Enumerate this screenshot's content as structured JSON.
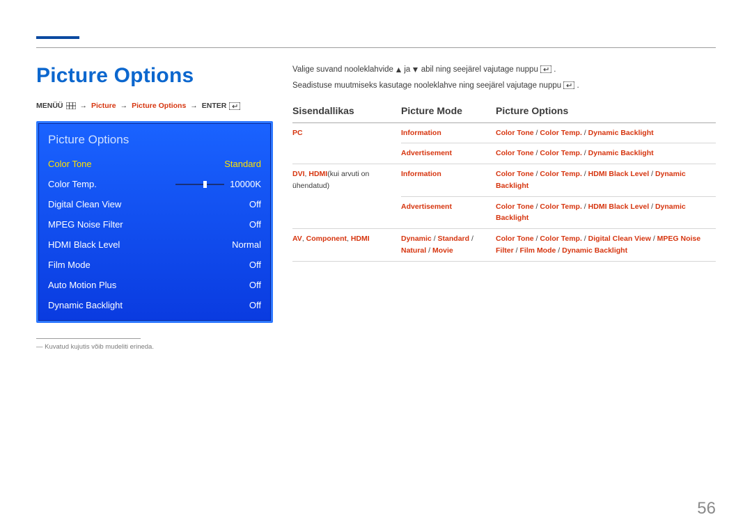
{
  "page_number": "56",
  "title": "Picture Options",
  "breadcrumb": {
    "menu": "MENÜÜ",
    "picture": "Picture",
    "picture_options": "Picture Options",
    "enter": "ENTER",
    "arrow": "→"
  },
  "osd": {
    "title": "Picture Options",
    "rows": [
      {
        "label": "Color Tone",
        "value": "Standard",
        "selected": true
      },
      {
        "label": "Color Temp.",
        "value": "10000K",
        "slider": true
      },
      {
        "label": "Digital Clean View",
        "value": "Off"
      },
      {
        "label": "MPEG Noise Filter",
        "value": "Off"
      },
      {
        "label": "HDMI Black Level",
        "value": "Normal"
      },
      {
        "label": "Film Mode",
        "value": "Off"
      },
      {
        "label": "Auto Motion Plus",
        "value": "Off"
      },
      {
        "label": "Dynamic Backlight",
        "value": "Off"
      }
    ]
  },
  "footnote": {
    "dash": "―",
    "text": "Kuvatud kujutis võib mudeliti erineda."
  },
  "instructions": {
    "line1_a": "Valige suvand nooleklahvide ",
    "line1_b": " ja ",
    "line1_c": " abil ning seejärel vajutage nuppu ",
    "line1_d": ".",
    "line2_a": "Seadistuse muutmiseks kasutage nooleklahve ning seejärel vajutage nuppu ",
    "line2_b": "."
  },
  "table": {
    "headers": [
      "Sisendallikas",
      "Picture Mode",
      "Picture Options"
    ],
    "rows": [
      {
        "src": [
          {
            "t": "PC",
            "r": true
          }
        ],
        "cells": [
          {
            "mode": [
              {
                "t": "Information",
                "r": true
              }
            ],
            "opts": [
              {
                "t": "Color Tone",
                "r": true
              },
              {
                "t": " / "
              },
              {
                "t": "Color Temp.",
                "r": true
              },
              {
                "t": " / "
              },
              {
                "t": "Dynamic Backlight",
                "r": true
              }
            ]
          },
          {
            "mode": [
              {
                "t": "Advertisement",
                "r": true
              }
            ],
            "opts": [
              {
                "t": "Color Tone",
                "r": true
              },
              {
                "t": " / "
              },
              {
                "t": "Color Temp.",
                "r": true
              },
              {
                "t": " / "
              },
              {
                "t": "Dynamic Backlight",
                "r": true
              }
            ]
          }
        ]
      },
      {
        "src": [
          {
            "t": "DVI",
            "r": true
          },
          {
            "t": ", "
          },
          {
            "t": "HDMI",
            "r": true
          },
          {
            "t": "(kui arvuti on ühendatud)"
          }
        ],
        "cells": [
          {
            "mode": [
              {
                "t": "Information",
                "r": true
              }
            ],
            "opts": [
              {
                "t": "Color Tone",
                "r": true
              },
              {
                "t": " / "
              },
              {
                "t": "Color Temp.",
                "r": true
              },
              {
                "t": " / "
              },
              {
                "t": "HDMI Black Level",
                "r": true
              },
              {
                "t": " / "
              },
              {
                "t": "Dynamic Backlight",
                "r": true
              }
            ]
          },
          {
            "mode": [
              {
                "t": "Advertisement",
                "r": true
              }
            ],
            "opts": [
              {
                "t": "Color Tone",
                "r": true
              },
              {
                "t": " / "
              },
              {
                "t": "Color Temp.",
                "r": true
              },
              {
                "t": " / "
              },
              {
                "t": "HDMI Black Level",
                "r": true
              },
              {
                "t": " / "
              },
              {
                "t": "Dynamic Backlight",
                "r": true
              }
            ]
          }
        ]
      },
      {
        "src": [
          {
            "t": "AV",
            "r": true
          },
          {
            "t": ", "
          },
          {
            "t": "Component",
            "r": true
          },
          {
            "t": ", "
          },
          {
            "t": "HDMI",
            "r": true
          }
        ],
        "cells": [
          {
            "mode": [
              {
                "t": "Dynamic",
                "r": true
              },
              {
                "t": " / "
              },
              {
                "t": "Standard",
                "r": true
              },
              {
                "t": " / "
              },
              {
                "t": "Natural",
                "r": true
              },
              {
                "t": " / "
              },
              {
                "t": "Movie",
                "r": true
              }
            ],
            "opts": [
              {
                "t": "Color Tone",
                "r": true
              },
              {
                "t": " / "
              },
              {
                "t": "Color Temp.",
                "r": true
              },
              {
                "t": " / "
              },
              {
                "t": "Digital Clean View",
                "r": true
              },
              {
                "t": " / "
              },
              {
                "t": "MPEG Noise Filter",
                "r": true
              },
              {
                "t": " / "
              },
              {
                "t": "Film Mode",
                "r": true
              },
              {
                "t": " / "
              },
              {
                "t": "Dynamic Backlight",
                "r": true
              }
            ]
          }
        ]
      }
    ]
  }
}
